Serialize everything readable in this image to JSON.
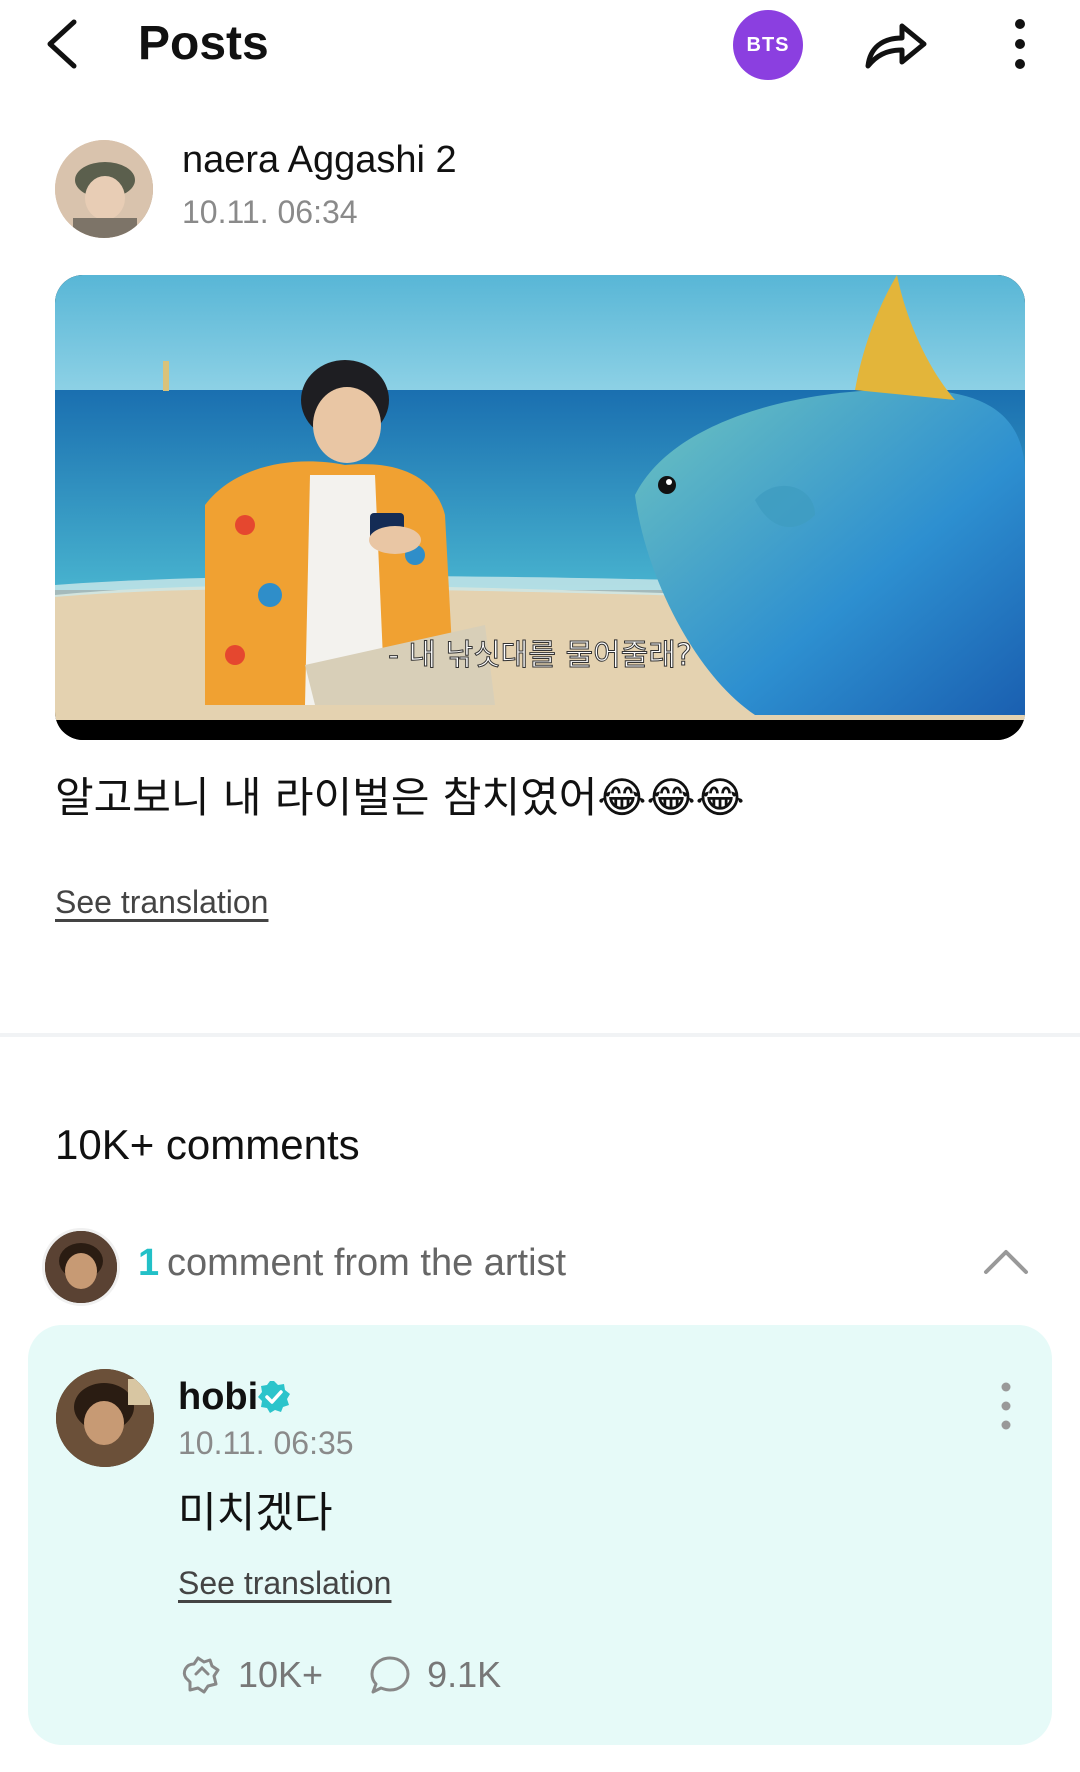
{
  "header": {
    "title": "Posts",
    "community_badge": "BTS",
    "accent": "#8b3fe0"
  },
  "post": {
    "author_name": "naera Aggashi 2",
    "timestamp": "10.11. 06:34",
    "image_caption": "- 내 낚싯대를 물어줄래?",
    "text": "알고보니 내 라이벌은 참치였어😂😂😂",
    "see_translation": "See translation"
  },
  "comments": {
    "count_label": "10K+ comments",
    "artist_comment_count": "1",
    "artist_comment_label": "comment from the artist",
    "artist_comment": {
      "name": "hobi",
      "timestamp": "10.11. 06:35",
      "text": "미치겠다",
      "see_translation": "See translation",
      "likes": "10K+",
      "replies": "9.1K",
      "card_bg": "#e6faf8",
      "verified_color": "#2cc4cb"
    }
  }
}
